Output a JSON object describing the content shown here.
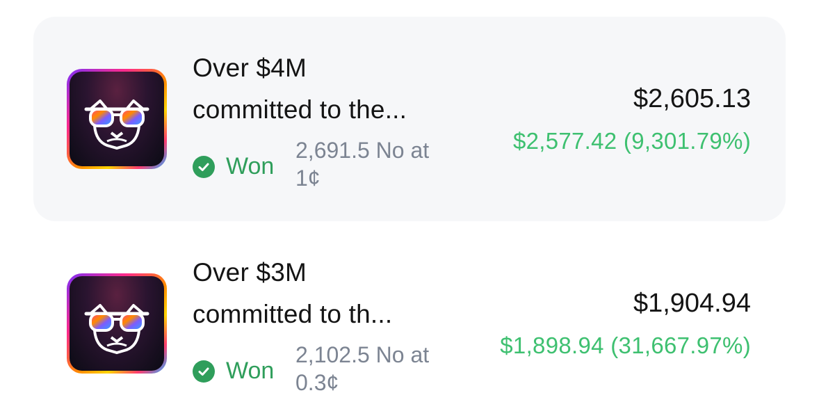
{
  "positions": [
    {
      "title_line1": "Over $4M",
      "title_line2": "committed to the...",
      "status": "Won",
      "position_line1": "2,691.5 No at",
      "position_line2": "1¢",
      "value": "$2,605.13",
      "gain": "$2,577.42 (9,301.79%)",
      "icon": "sunglasses-mascot-icon"
    },
    {
      "title_line1": "Over $3M",
      "title_line2": "committed to th...",
      "status": "Won",
      "position_line1": "2,102.5 No at",
      "position_line2": "0.3¢",
      "value": "$1,904.94",
      "gain": "$1,898.94 (31,667.97%)",
      "icon": "sunglasses-mascot-icon"
    }
  ],
  "colors": {
    "won_green": "#2f9e5b",
    "gain_green": "#3ec070",
    "muted_text": "#7c8492",
    "highlight_bg": "#f6f7f9"
  }
}
